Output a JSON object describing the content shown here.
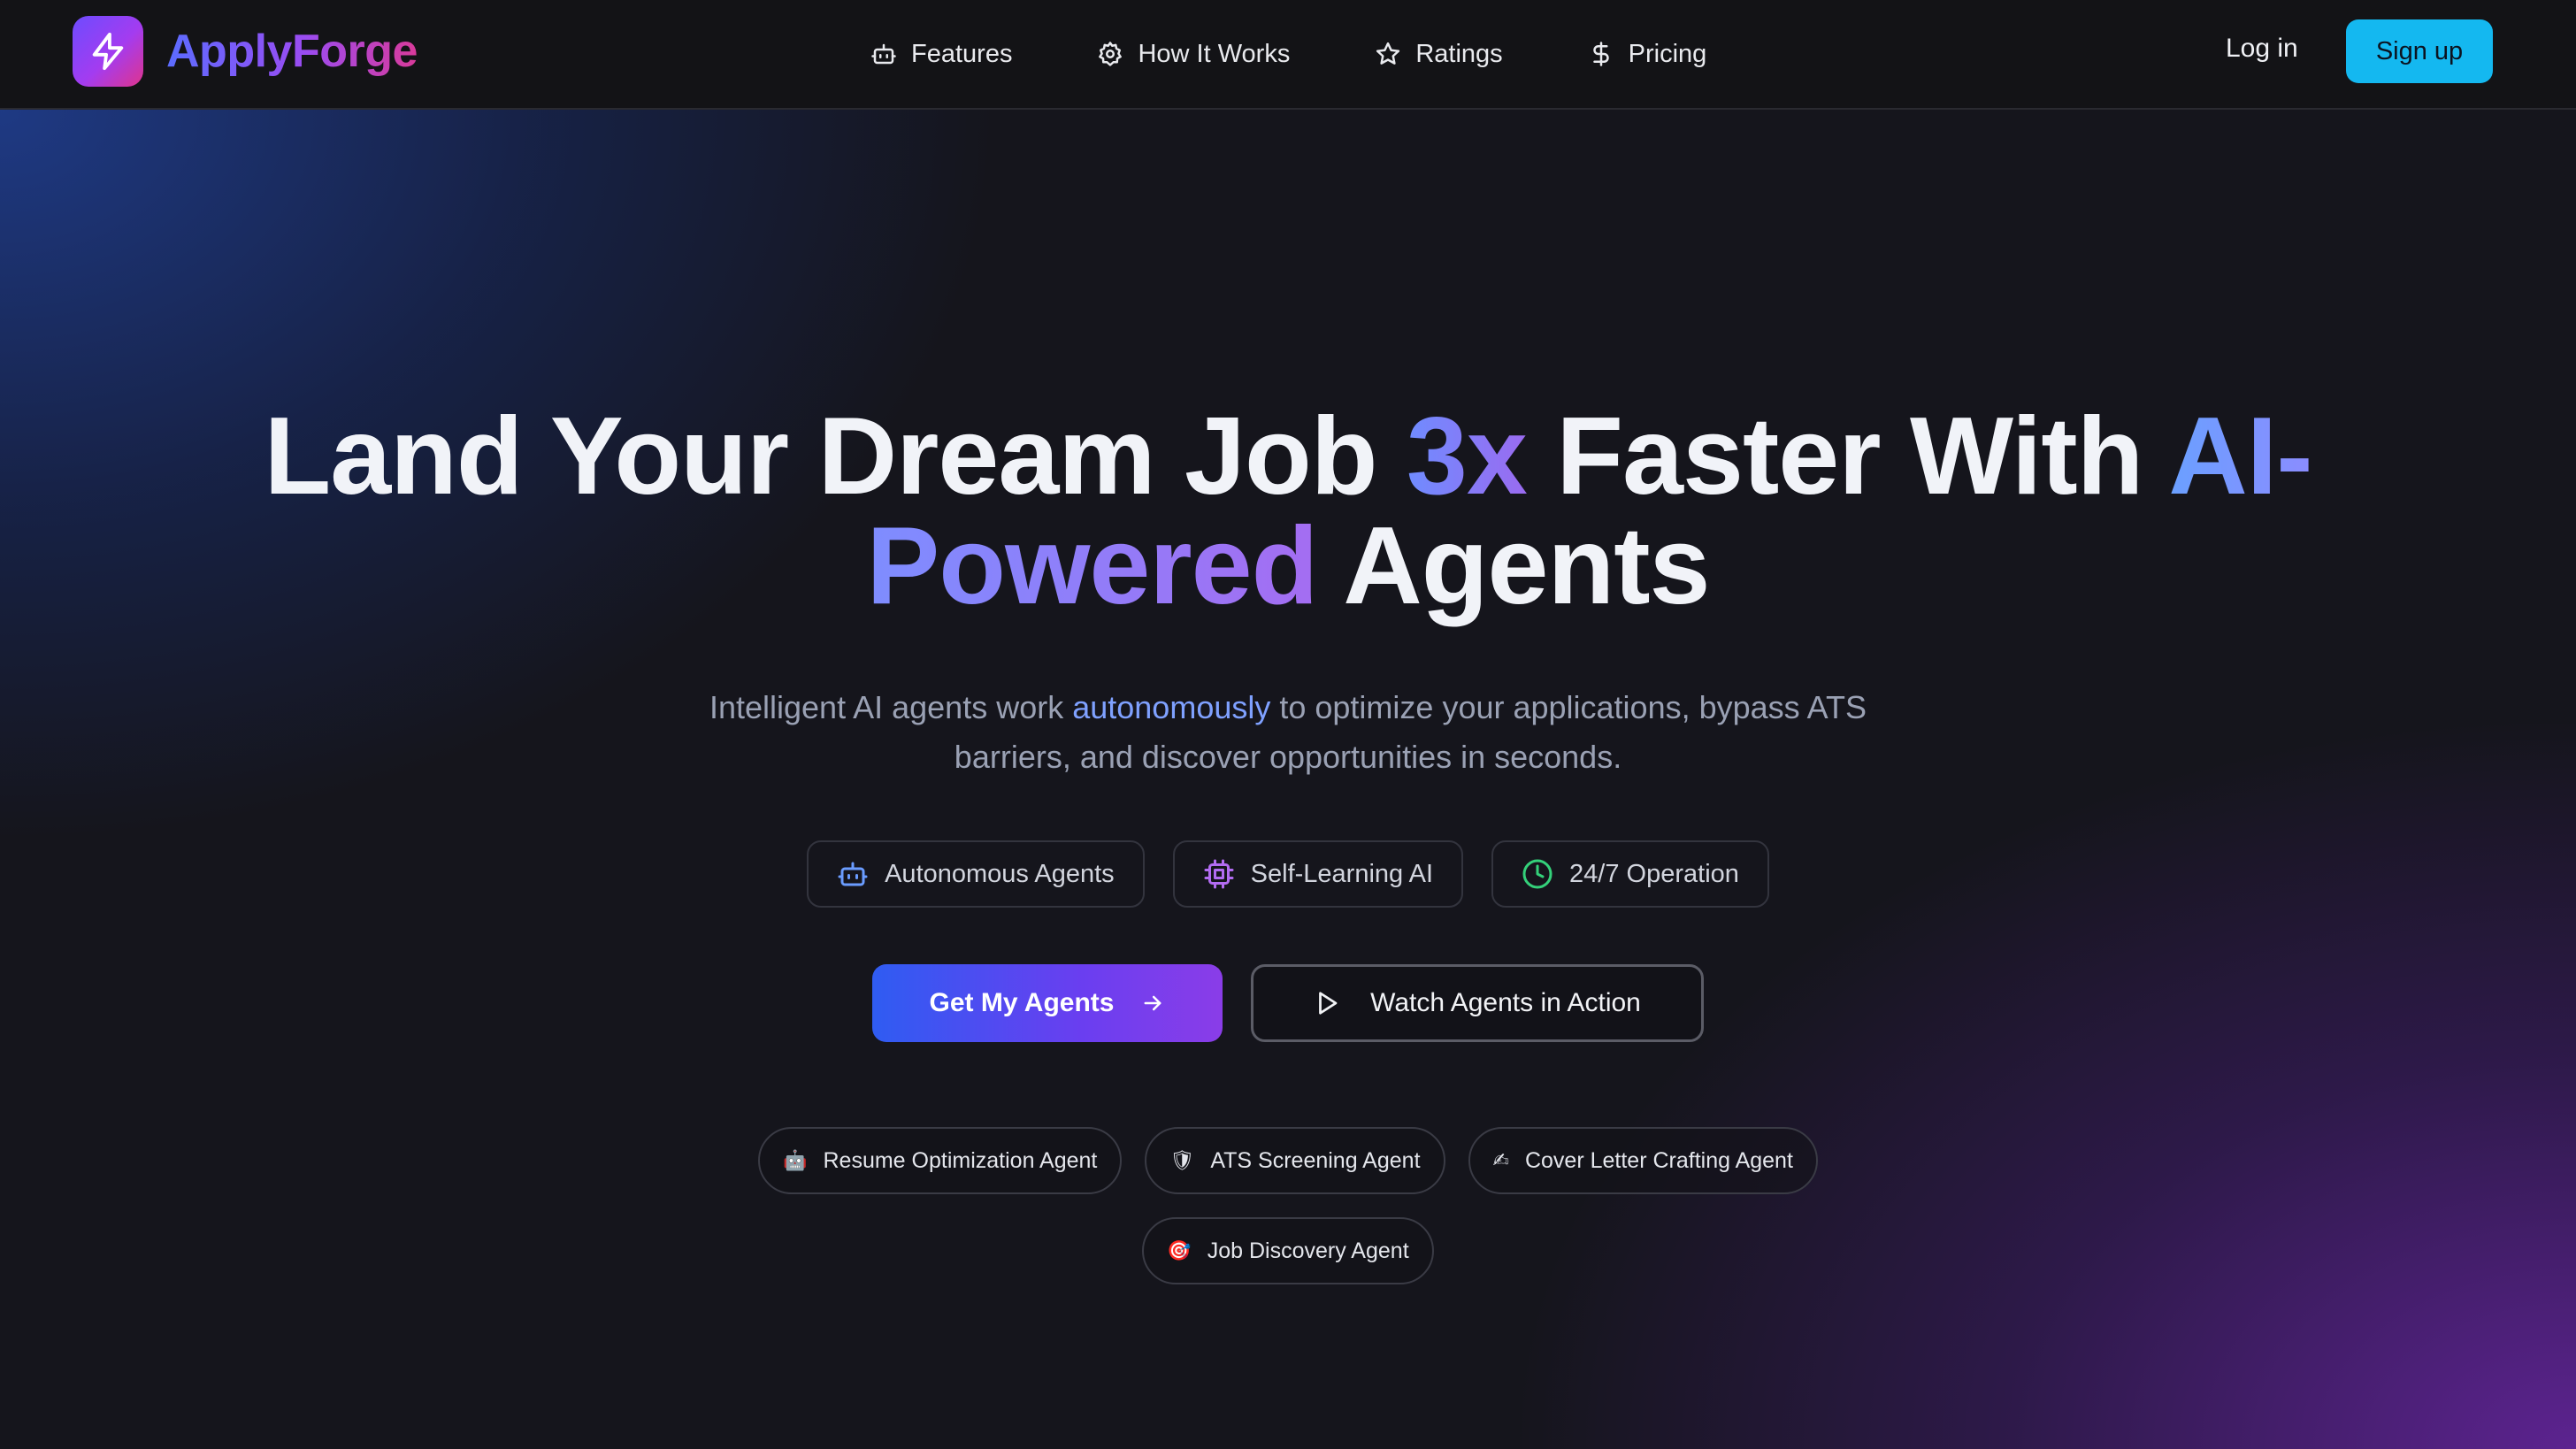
{
  "brand": {
    "name": "ApplyForge",
    "logo_icon": "lightning-bolt-icon"
  },
  "nav": {
    "links": [
      {
        "label": "Features",
        "icon": "robot-icon"
      },
      {
        "label": "How It Works",
        "icon": "gear-icon"
      },
      {
        "label": "Ratings",
        "icon": "star-icon"
      },
      {
        "label": "Pricing",
        "icon": "dollar-icon"
      }
    ],
    "login_label": "Log in",
    "signup_label": "Sign up"
  },
  "hero": {
    "headline": {
      "part1": "Land Your Dream Job ",
      "highlight1": "3x",
      "part2": " Faster With ",
      "highlight2": "AI-",
      "highlight3": "Powered",
      "part3": " Agents"
    },
    "subtitle": {
      "part1": "Intelligent AI agents work ",
      "highlight": "autonomously",
      "part2": " to optimize your applications, bypass ATS barriers, and discover opportunities in seconds."
    },
    "features": [
      {
        "label": "Autonomous Agents",
        "icon": "robot-icon"
      },
      {
        "label": "Self-Learning AI",
        "icon": "chip-icon"
      },
      {
        "label": "24/7 Operation",
        "icon": "clock-icon"
      }
    ],
    "cta_primary": "Get My Agents",
    "cta_secondary": "Watch Agents in Action",
    "agents": [
      {
        "emoji": "🤖",
        "label": "Resume Optimization Agent"
      },
      {
        "emoji": "🛡",
        "label": "ATS Screening Agent"
      },
      {
        "emoji": "✍",
        "label": "Cover Letter Crafting Agent"
      },
      {
        "emoji": "🎯",
        "label": "Job Discovery Agent"
      }
    ]
  },
  "colors": {
    "accent_signup": "#14b8f0",
    "brand_gradient_start": "#5b6cff",
    "brand_gradient_end": "#d93a9a",
    "cta_gradient_start": "#2f5cf2",
    "cta_gradient_end": "#8a3de8"
  }
}
